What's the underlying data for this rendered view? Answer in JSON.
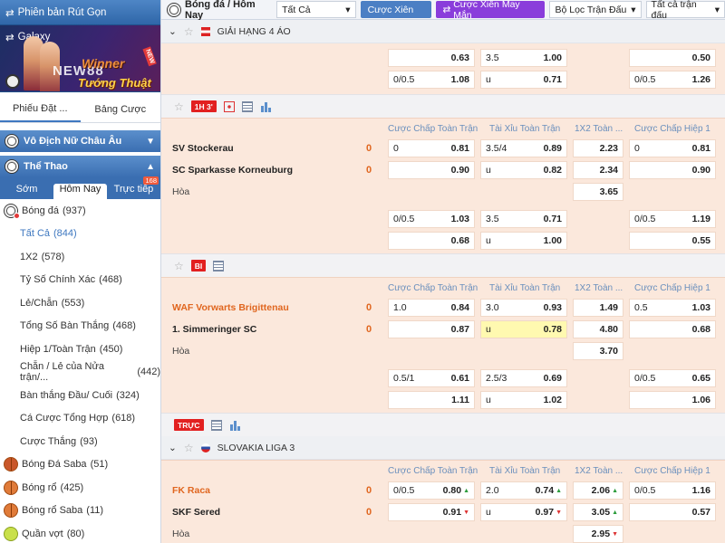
{
  "sidebar": {
    "quick_version": "Phiên bản Rút Gọn",
    "banner": {
      "label": "Galaxy",
      "logo": "NEW88",
      "promo_line1": "Winner",
      "promo_line2": "Tướng Thuật",
      "badge": "NEW"
    },
    "tabs": [
      "Phiếu Đặt ...",
      "Bảng Cược"
    ],
    "section_euro": "Vô Địch Nữ Châu Âu",
    "section_sports": "Thể Thao",
    "subtabs": [
      "Sớm",
      "Hôm Nay",
      "Trực tiếp"
    ],
    "subtab_badge": "168",
    "items": [
      {
        "label": "Bóng đá",
        "count": "(937)"
      },
      {
        "label": "Tất Cả",
        "count": "(844)"
      },
      {
        "label": "1X2",
        "count": "(578)"
      },
      {
        "label": "Tỷ Số Chính Xác",
        "count": "(468)"
      },
      {
        "label": "Lẻ/Chẵn",
        "count": "(553)"
      },
      {
        "label": "Tổng Số Bàn Thắng",
        "count": "(468)"
      },
      {
        "label": "Hiệp 1/Toàn Trận",
        "count": "(450)"
      },
      {
        "label": "Chẵn / Lẻ của Nửa trận/...",
        "count": "(442)"
      },
      {
        "label": "Bàn thắng Đầu/ Cuối",
        "count": "(324)"
      },
      {
        "label": "Cá Cược Tổng Hợp",
        "count": "(618)"
      },
      {
        "label": "Cược Thắng",
        "count": "(93)"
      },
      {
        "label": "Bóng Đá Saba",
        "count": "(51)"
      },
      {
        "label": "Bóng rổ",
        "count": "(425)"
      },
      {
        "label": "Bóng rổ Saba",
        "count": "(11)"
      },
      {
        "label": "Quần vợt",
        "count": "(80)"
      }
    ]
  },
  "topbar": {
    "title": "Bóng đá / Hôm Nay",
    "filter_all": "Tất Cả",
    "btn_parlay": "Cược Xiên",
    "btn_lucky_parlay": "Cược Xiên May Mắn",
    "match_filter": "Bộ Lọc Trận Đấu",
    "all_matches": "Tất cả trận đấu"
  },
  "columns": {
    "hdp_full": "Cược Chấp Toàn Trận",
    "ou_full": "Tài Xỉu Toàn Trận",
    "x12_full": "1X2 Toàn ...",
    "hdp_half": "Cược Chấp Hiệp 1"
  },
  "league1": {
    "name": "GIẢI HẠNG 4 ÁO",
    "rows": [
      {
        "c1a": "",
        "c1b": "0.63",
        "c2a": "3.5",
        "c2b": "1.00",
        "c4a": "",
        "c4b": "0.50"
      },
      {
        "c1a": "0/0.5",
        "c1b": "1.08",
        "c2a": "u",
        "c2b": "0.71",
        "c4a": "0/0.5",
        "c4b": "1.26"
      }
    ]
  },
  "match1": {
    "live_badge": "1H 3'",
    "home": "SV Stockerau",
    "away": "SC Sparkasse Korneuburg",
    "home_score": "0",
    "away_score": "0",
    "draw": "Hòa",
    "rows": [
      {
        "c1a": "0",
        "c1b": "0.81",
        "c2a": "3.5/4",
        "c2b": "0.89",
        "c3": "2.23",
        "c4a": "0",
        "c4b": "0.81"
      },
      {
        "c1a": "",
        "c1b": "0.90",
        "c2a": "u",
        "c2b": "0.82",
        "c3": "2.34",
        "c4a": "",
        "c4b": "0.90"
      },
      {
        "c3": "3.65"
      },
      {
        "c1a": "0/0.5",
        "c1b": "1.03",
        "c2a": "3.5",
        "c2b": "0.71",
        "c4a": "0/0.5",
        "c4b": "1.19"
      },
      {
        "c1a": "",
        "c1b": "0.68",
        "c2a": "u",
        "c2b": "1.00",
        "c4a": "",
        "c4b": "0.55"
      }
    ]
  },
  "match2": {
    "live_badge": "BI",
    "home": "WAF Vorwarts Brigittenau",
    "away": "1. Simmeringer SC",
    "home_score": "0",
    "away_score": "0",
    "draw": "Hòa",
    "rows": [
      {
        "c1a": "1.0",
        "c1b": "0.84",
        "c2a": "3.0",
        "c2b": "0.93",
        "c3": "1.49",
        "c4a": "0.5",
        "c4b": "1.03"
      },
      {
        "c1a": "",
        "c1b": "0.87",
        "c2a": "u",
        "c2b": "0.78",
        "c3": "4.80",
        "c4a": "",
        "c4b": "0.68"
      },
      {
        "c3": "3.70"
      },
      {
        "c1a": "0.5/1",
        "c1b": "0.61",
        "c2a": "2.5/3",
        "c2b": "0.69",
        "c4a": "0/0.5",
        "c4b": "0.65"
      },
      {
        "c1a": "",
        "c1b": "1.11",
        "c2a": "u",
        "c2b": "1.02",
        "c4a": "",
        "c4b": "1.06"
      }
    ]
  },
  "iconrow3": {
    "live_badge": "TRỰC"
  },
  "league2": {
    "name": "SLOVAKIA LIGA 3"
  },
  "match3": {
    "home": "FK Raca",
    "away": "SKF Sered",
    "home_score": "0",
    "away_score": "0",
    "draw": "Hòa",
    "rows": [
      {
        "c1a": "0/0.5",
        "c1b": "0.80",
        "c2a": "2.0",
        "c2b": "0.74",
        "c3": "2.06",
        "c4a": "0/0.5",
        "c4b": "1.16"
      },
      {
        "c1a": "",
        "c1b": "0.91",
        "c2a": "u",
        "c2b": "0.97",
        "c3": "3.05",
        "c4a": "",
        "c4b": "0.57"
      },
      {
        "c3": "2.95"
      }
    ]
  }
}
